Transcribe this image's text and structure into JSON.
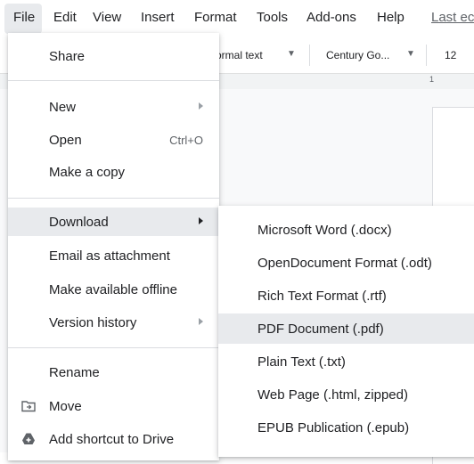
{
  "menubar": {
    "items": [
      "File",
      "Edit",
      "View",
      "Insert",
      "Format",
      "Tools",
      "Add-ons",
      "Help"
    ],
    "last_edit": "Last ec"
  },
  "toolbar": {
    "style": "ormal text",
    "font": "Century Go...",
    "size": "12"
  },
  "ruler": {
    "mark": "1"
  },
  "file_menu": {
    "share": "Share",
    "new": "New",
    "open": "Open",
    "open_shortcut": "Ctrl+O",
    "make_copy": "Make a copy",
    "download": "Download",
    "email": "Email as attachment",
    "offline": "Make available offline",
    "version_history": "Version history",
    "rename": "Rename",
    "move": "Move",
    "add_shortcut": "Add shortcut to Drive"
  },
  "download_menu": {
    "items": [
      "Microsoft Word (.docx)",
      "OpenDocument Format (.odt)",
      "Rich Text Format (.rtf)",
      "PDF Document (.pdf)",
      "Plain Text (.txt)",
      "Web Page (.html, zipped)",
      "EPUB Publication (.epub)"
    ],
    "highlighted": "PDF Document (.pdf)"
  },
  "colors": {
    "hover": "#e8eaed",
    "text": "#202124",
    "secondary": "#5f6368"
  }
}
